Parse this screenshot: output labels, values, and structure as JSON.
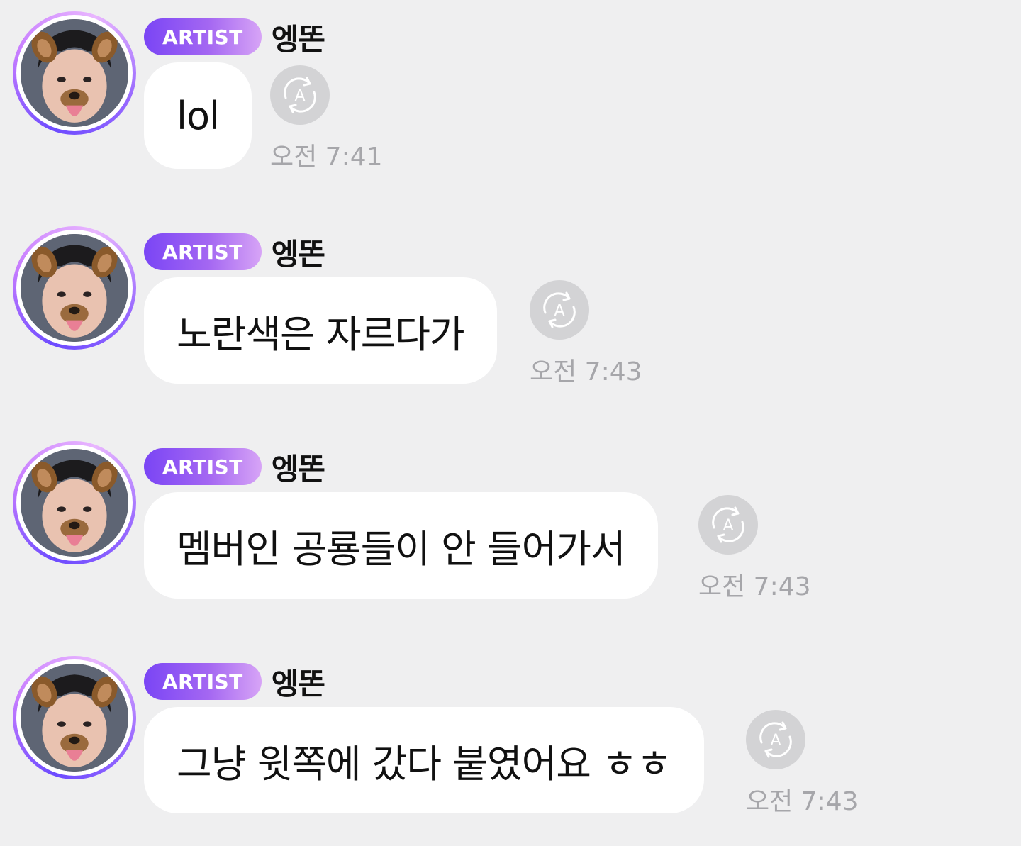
{
  "messages": [
    {
      "badge": "ARTIST",
      "sender": "엥똔",
      "text": "lol",
      "time": "오전 7:41",
      "translate_icon": "translate-a-icon"
    },
    {
      "badge": "ARTIST",
      "sender": "엥똔",
      "text": "노란색은 자르다가",
      "time": "오전 7:43",
      "translate_icon": "translate-a-icon"
    },
    {
      "badge": "ARTIST",
      "sender": "엥똔",
      "text": "멤버인 공룡들이 안 들어가서",
      "time": "오전 7:43",
      "translate_icon": "translate-a-icon"
    },
    {
      "badge": "ARTIST",
      "sender": "엥똔",
      "text": "그냥 윗쪽에 갔다 붙였어요 ㅎㅎ",
      "time": "오전 7:43",
      "translate_icon": "translate-a-icon"
    }
  ],
  "colors": {
    "background": "#efeff0",
    "bubble": "#ffffff",
    "badge_start": "#7a45f5",
    "badge_end": "#d7a4f6",
    "time_text": "#a6a6aa",
    "translate_button": "#d3d3d5"
  }
}
